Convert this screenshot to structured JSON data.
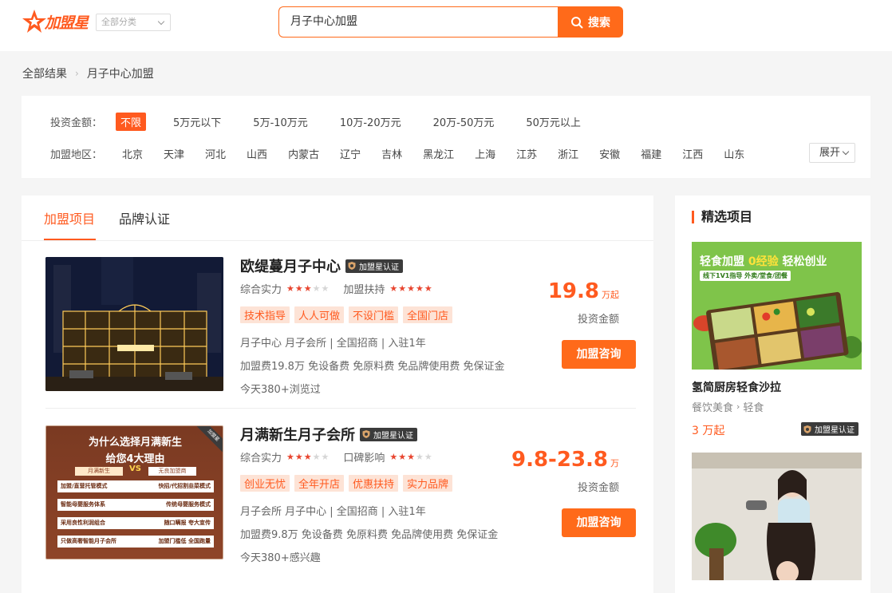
{
  "header": {
    "logo_text": "加盟星",
    "category_placeholder": "全部分类",
    "search_value": "月子中心加盟",
    "search_button": "搜索"
  },
  "breadcrumb": {
    "root": "全部结果",
    "current": "月子中心加盟"
  },
  "filters": {
    "investment": {
      "label": "投资金额：",
      "options": [
        "不限",
        "5万元以下",
        "5万-10万元",
        "10万-20万元",
        "20万-50万元",
        "50万元以上"
      ],
      "selected": "不限"
    },
    "region": {
      "label": "加盟地区：",
      "options": [
        "北京",
        "天津",
        "河北",
        "山西",
        "内蒙古",
        "辽宁",
        "吉林",
        "黑龙江",
        "上海",
        "江苏",
        "浙江",
        "安徽",
        "福建",
        "江西",
        "山东"
      ],
      "expand_label": "展开"
    }
  },
  "tabs": [
    {
      "label": "加盟项目",
      "active": true
    },
    {
      "label": "品牌认证",
      "active": false
    }
  ],
  "items": [
    {
      "name": "欧缇蔓月子中心",
      "cert": "加盟星认证",
      "rating1_label": "综合实力",
      "rating1_stars": 3,
      "rating2_label": "加盟扶持",
      "rating2_stars": 5,
      "tags": [
        "技术指导",
        "人人可做",
        "不设门槛",
        "全国门店"
      ],
      "category_line": "月子中心 月子会所 | 全国招商 | 入驻1年",
      "fee_line": "加盟费19.8万 免设备费 免原料费 免品牌使用费 免保证金",
      "visits": "今天380+浏览过",
      "price": "19.8",
      "price_unit": "万起",
      "price_label": "投资金额",
      "button": "加盟咨询",
      "image_sign": "欧缇蔓国际母婴会所"
    },
    {
      "name": "月满新生月子会所",
      "cert": "加盟星认证",
      "rating1_label": "综合实力",
      "rating1_stars": 3,
      "rating2_label": "口碑影响",
      "rating2_stars": 3,
      "tags": [
        "创业无忧",
        "全年开店",
        "优惠扶持",
        "实力品牌"
      ],
      "category_line": "月子会所 月子中心 | 全国招商 | 入驻1年",
      "fee_line": "加盟费9.8万 免设备费 免原料费 免品牌使用费 免保证金",
      "visits": "今天380+感兴趣",
      "price": "9.8-23.8",
      "price_unit": "万",
      "price_label": "投资金额",
      "button": "加盟咨询",
      "poster": {
        "line1": "为什么选择月满新生",
        "line2": "给您4大理由",
        "left_head": "月满新生",
        "vs": "VS",
        "right_head": "无良加盟商",
        "rows": [
          [
            "加盟/直营托管模式",
            "快招/代招割韭菜模式"
          ],
          [
            "智能母婴服务体系",
            "传统母婴服务模式"
          ],
          [
            "采用良性利润组合",
            "随口瞒报 夸大宣传"
          ],
          [
            "只做高奢智能月子会所",
            "加盟门槛低 全国跑量"
          ]
        ],
        "corner": "加盟星"
      }
    }
  ],
  "sidebar": {
    "title": "精选项目",
    "card1": {
      "banner_main": "轻食加盟",
      "banner_zero": "0经验",
      "banner_tail": "轻松创业",
      "banner_sub": "线下1V1指导  外卖/堂食/团餐",
      "name": "氢简厨房轻食沙拉",
      "cat_parent": "餐饮美食",
      "cat_child": "轻食",
      "price": "3 万起",
      "cert": "加盟星认证"
    }
  },
  "colors": {
    "accent": "#ff5a1f",
    "button": "#ff6a1a",
    "tag_bg": "#fde3d6",
    "cert_bg": "#3b3b3b"
  }
}
